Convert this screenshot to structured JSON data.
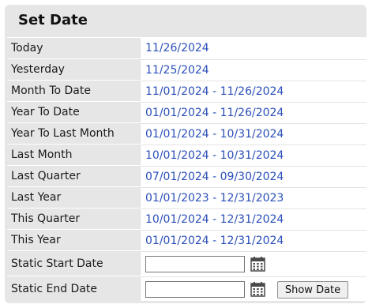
{
  "title": "Set Date",
  "ranges": [
    {
      "label": "Today",
      "value": "11/26/2024"
    },
    {
      "label": "Yesterday",
      "value": "11/25/2024"
    },
    {
      "label": "Month To Date",
      "value": "11/01/2024 - 11/26/2024"
    },
    {
      "label": "Year To Date",
      "value": "01/01/2024 - 11/26/2024"
    },
    {
      "label": "Year To Last Month",
      "value": "01/01/2024 - 10/31/2024"
    },
    {
      "label": "Last Month",
      "value": "10/01/2024 - 10/31/2024"
    },
    {
      "label": "Last Quarter",
      "value": "07/01/2024 - 09/30/2024"
    },
    {
      "label": "Last Year",
      "value": "01/01/2023 - 12/31/2023"
    },
    {
      "label": "This Quarter",
      "value": "10/01/2024 - 12/31/2024"
    },
    {
      "label": "This Year",
      "value": "01/01/2024 - 12/31/2024"
    }
  ],
  "static_start": {
    "label": "Static Start Date",
    "value": "",
    "icon": "calendar-icon"
  },
  "static_end": {
    "label": "Static End Date",
    "value": "",
    "icon": "calendar-icon"
  },
  "show_button": "Show Date",
  "colors": {
    "panel": "#e6e6e6",
    "link": "#2a4fb9",
    "text": "#1a1a1a"
  }
}
